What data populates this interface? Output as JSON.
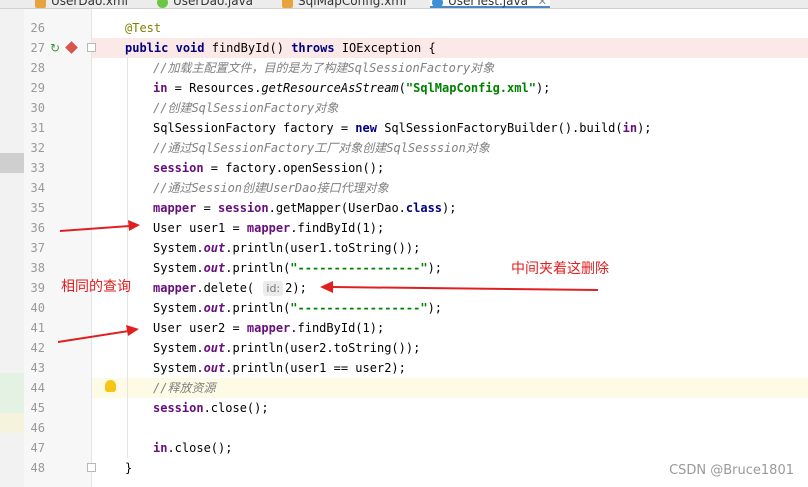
{
  "tabs": [
    {
      "label": "UserDao.xml",
      "icon": "xml-file-icon",
      "active": false
    },
    {
      "label": "UserDao.java",
      "icon": "interface-file-icon",
      "active": false
    },
    {
      "label": "SqlMapConfig.xml",
      "icon": "xml-file-icon",
      "active": false
    },
    {
      "label": "UserTest.java",
      "icon": "class-file-icon",
      "active": true
    }
  ],
  "lines": [
    {
      "num": "26",
      "text": "@Test"
    },
    {
      "num": "27",
      "text": "public void findById() throws IOException {"
    },
    {
      "num": "28",
      "text": "//加载主配置文件，目的是为了构建SqlSessionFactory对象"
    },
    {
      "num": "29",
      "text": "in = Resources.getResourceAsStream(\"SqlMapConfig.xml\");"
    },
    {
      "num": "30",
      "text": "//创建SqlSessionFactory对象"
    },
    {
      "num": "31",
      "text": "SqlSessionFactory factory = new SqlSessionFactoryBuilder().build(in);"
    },
    {
      "num": "32",
      "text": "//通过SqlSessionFactory工厂对象创建SqlSesssion对象"
    },
    {
      "num": "33",
      "text": "session = factory.openSession();"
    },
    {
      "num": "34",
      "text": "//通过Session创建UserDao接口代理对象"
    },
    {
      "num": "35",
      "text": "mapper = session.getMapper(UserDao.class);"
    },
    {
      "num": "36",
      "text": "User user1 = mapper.findById(1);"
    },
    {
      "num": "37",
      "text": "System.out.println(user1.toString());"
    },
    {
      "num": "38",
      "text": "System.out.println(\"-----------------\");"
    },
    {
      "num": "39",
      "text": "mapper.delete( id: 2);"
    },
    {
      "num": "40",
      "text": "System.out.println(\"-----------------\");"
    },
    {
      "num": "41",
      "text": "User user2 = mapper.findById(1);"
    },
    {
      "num": "42",
      "text": "System.out.println(user2.toString());"
    },
    {
      "num": "43",
      "text": "System.out.println(user1 == user2);"
    },
    {
      "num": "44",
      "text": "//释放资源"
    },
    {
      "num": "45",
      "text": "session.close();"
    },
    {
      "num": "46",
      "text": ""
    },
    {
      "num": "47",
      "text": "in.close();"
    },
    {
      "num": "48",
      "text": "}"
    }
  ],
  "annotations": {
    "same_query": "相同的查询",
    "delete_in_middle": "中间夹着这删除"
  },
  "watermark": "CSDN @Bruce1801",
  "colors": {
    "keyword": "#000080",
    "string": "#008000",
    "field": "#660e7a",
    "comment": "#808080",
    "annotation": "#808000",
    "red_annotation": "#e02020"
  }
}
